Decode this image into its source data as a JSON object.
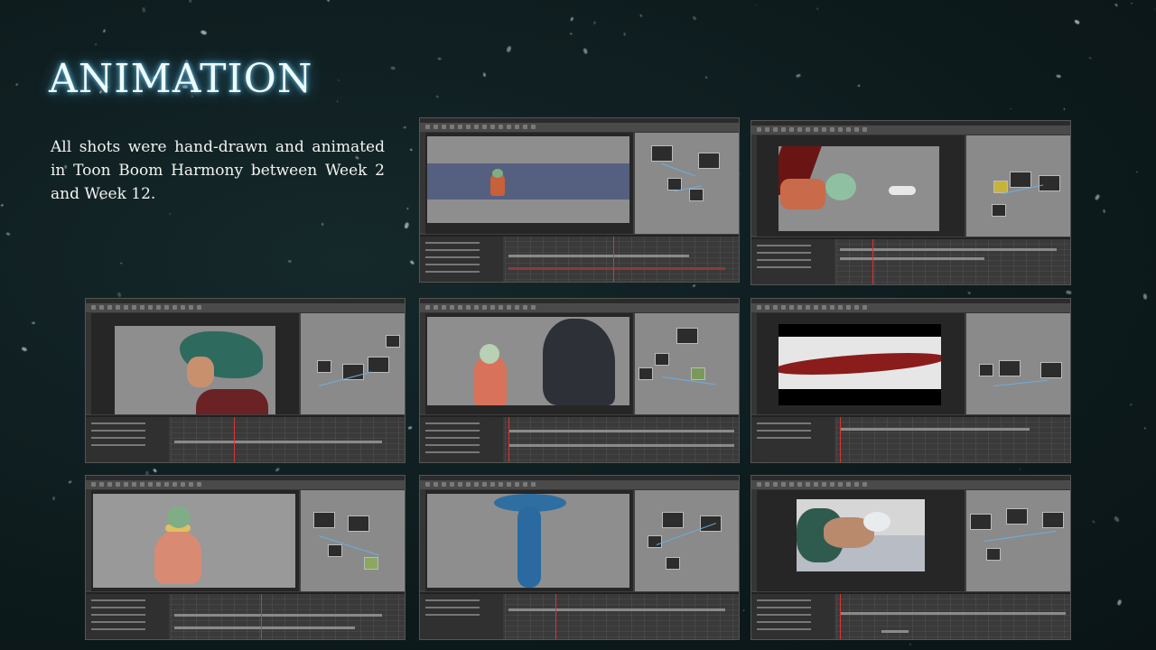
{
  "slide": {
    "title": "ANIMATION",
    "description": "All shots were hand-drawn and animated in Toon Boom Harmony between Week 2 and Week 12."
  },
  "colors": {
    "background": "#0e1c1e",
    "title_glow": "#7fdcff",
    "text": "#f2f2f2",
    "app_chrome": "#3f3f3f",
    "stage_gray": "#8e8e8e",
    "node_wire": "#6ab0e0",
    "playhead": "#dd3333"
  },
  "shots": [
    {
      "subject": "character-in-red-cloak-on-blue-river"
    },
    {
      "subject": "hooded-character-with-ferret"
    },
    {
      "subject": "green-haired-character-profile"
    },
    {
      "subject": "hooded-character-facing-wolf"
    },
    {
      "subject": "red-flowing-smoke"
    },
    {
      "subject": "hooded-character-in-pink-cloak"
    },
    {
      "subject": "blue-magic-plume"
    },
    {
      "subject": "sleeping-character-with-oxygen-mask"
    }
  ]
}
